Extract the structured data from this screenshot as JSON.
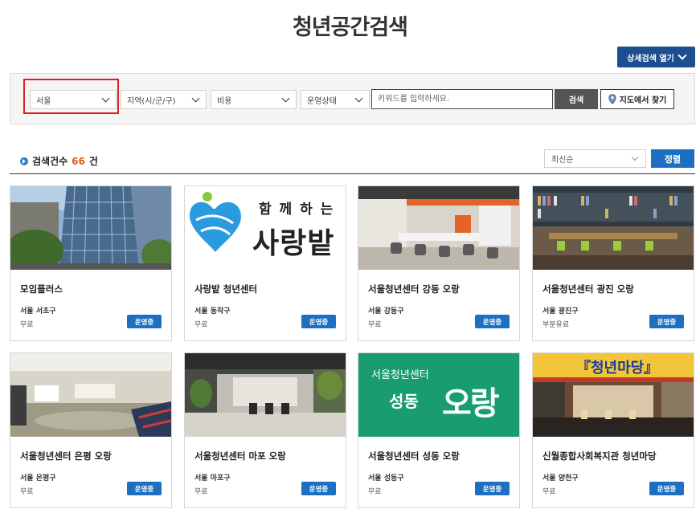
{
  "page_title": "청년공간검색",
  "advanced_search_label": "상세검색 열기",
  "filters": {
    "city": "서울",
    "district": "지역(시/군/구)",
    "cost": "비용",
    "status": "운영상태",
    "keyword_placeholder": "키워드를 입력하세요.",
    "search_label": "검색",
    "map_label": "지도에서 찾기"
  },
  "results": {
    "count_prefix": "검색건수",
    "count": "66",
    "count_suffix": "건",
    "sort_value": "최신순",
    "sort_button": "정렬"
  },
  "cards": [
    {
      "name": "모임플러스",
      "location": "서울 서초구",
      "fee": "무료",
      "status": "운영중"
    },
    {
      "name": "사랑밭 청년센터",
      "location": "서울 동작구",
      "fee": "무료",
      "status": "운영중",
      "logo_line1": "함 께 하 는",
      "logo_line2": "사랑밭"
    },
    {
      "name": "서울청년센터 강동 오랑",
      "location": "서울 강동구",
      "fee": "무료",
      "status": "운영중"
    },
    {
      "name": "서울청년센터 광진 오랑",
      "location": "서울 광진구",
      "fee": "부분유료",
      "status": "운영중"
    },
    {
      "name": "서울청년센터 은평 오랑",
      "location": "서울 은평구",
      "fee": "무료",
      "status": "운영중"
    },
    {
      "name": "서울청년센터 마포 오랑",
      "location": "서울 마포구",
      "fee": "무료",
      "status": "운영중"
    },
    {
      "name": "서울청년센터 성동 오랑",
      "location": "서울 성동구",
      "fee": "무료",
      "status": "운영중",
      "logo_line1": "서울청년센터",
      "logo_line2": "성동",
      "logo_word": "오랑"
    },
    {
      "name": "신월종합사회복지관 청년마당",
      "location": "서울 양천구",
      "fee": "무료",
      "status": "운영중",
      "banner": "『청년마당』"
    }
  ],
  "colors": {
    "primary": "#1d6fc2",
    "nav_dark": "#1d4e8f",
    "highlight": "#e02020",
    "count": "#e05b1a"
  }
}
